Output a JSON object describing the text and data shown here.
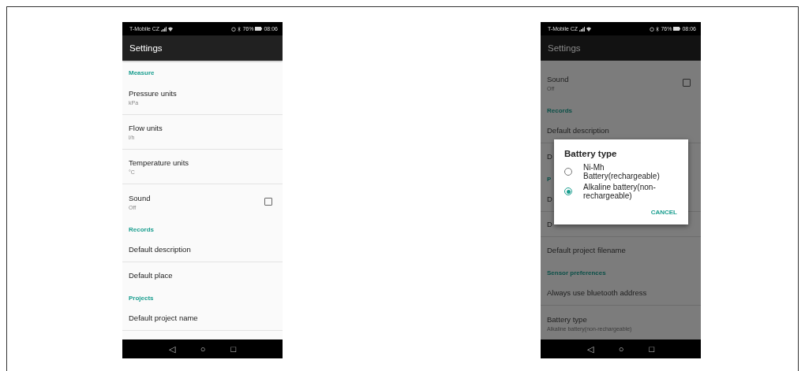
{
  "screens": [
    {
      "status_bar": {
        "carrier": "T-Mobile CZ",
        "battery": "76%",
        "time": "08:06"
      },
      "title": "Settings",
      "dimmed": false,
      "items": [
        {
          "kind": "header",
          "title": "Measure"
        },
        {
          "kind": "item",
          "title": "Pressure units",
          "summary": "kPa"
        },
        {
          "kind": "item",
          "title": "Flow units",
          "summary": "l/h"
        },
        {
          "kind": "item",
          "title": "Temperature units",
          "summary": "°C"
        },
        {
          "kind": "checkbox",
          "title": "Sound",
          "summary": "Off",
          "checked": false
        },
        {
          "kind": "header",
          "title": "Records"
        },
        {
          "kind": "item",
          "title": "Default description"
        },
        {
          "kind": "item",
          "title": "Default place"
        },
        {
          "kind": "header",
          "title": "Projects"
        },
        {
          "kind": "item",
          "title": "Default project name"
        },
        {
          "kind": "item"
        }
      ],
      "nav": [
        "◁",
        "○",
        "□"
      ]
    },
    {
      "status_bar": {
        "carrier": "T-Mobile CZ",
        "battery": "76%",
        "time": "08:06"
      },
      "title": "Settings",
      "dimmed": true,
      "items": [
        {
          "kind": "checkbox",
          "title": "Sound",
          "summary": "Off",
          "checked": false
        },
        {
          "kind": "header",
          "title": "Records"
        },
        {
          "kind": "item",
          "title": "Default description"
        },
        {
          "kind": "item",
          "title": "D"
        },
        {
          "kind": "header",
          "title": "P"
        },
        {
          "kind": "item",
          "title": "D"
        },
        {
          "kind": "item",
          "title": "D"
        },
        {
          "kind": "item",
          "title": "Default project filename"
        },
        {
          "kind": "header",
          "title": "Sensor preferences"
        },
        {
          "kind": "item",
          "title": "Always use bluetooth address"
        },
        {
          "kind": "item",
          "title": "Battery type",
          "summary": "Alkaline battery(non-rechargeable)"
        }
      ],
      "nav": [
        "◁",
        "○",
        "□"
      ],
      "dialog": {
        "title": "Battery type",
        "options": [
          {
            "label": "Ni-Mh Battery(rechargeable)",
            "selected": false
          },
          {
            "label": "Alkaline battery(non-rechargeable)",
            "selected": true
          }
        ],
        "button": "CANCEL"
      }
    }
  ]
}
